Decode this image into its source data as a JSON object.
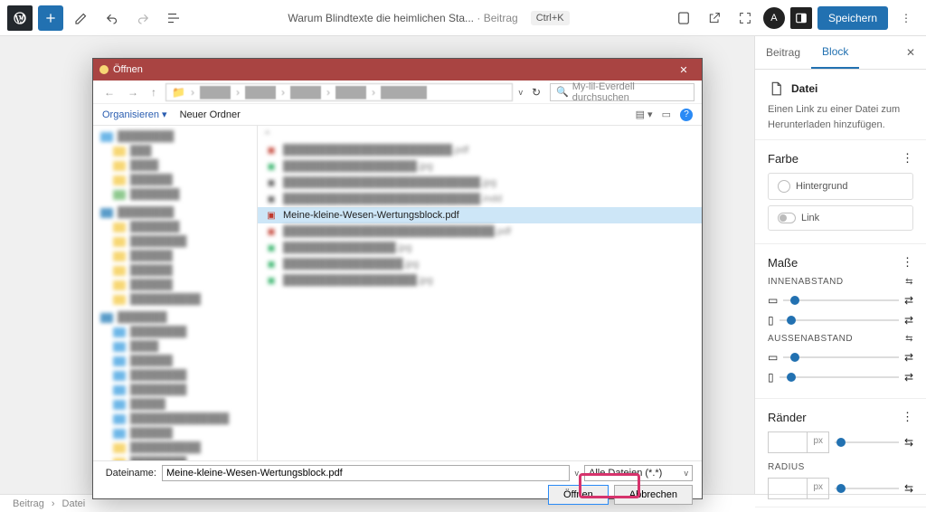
{
  "header": {
    "post_title": "Warum Blindtexte die heimlichen Sta...",
    "post_suffix": "· Beitrag",
    "shortcut": "Ctrl+K",
    "save": "Speichern"
  },
  "sidebar": {
    "tabs": {
      "post": "Beitrag",
      "block": "Block"
    },
    "block": {
      "name": "Datei",
      "desc": "Einen Link zu einer Datei zum Herunterladen hinzufügen."
    },
    "color": {
      "title": "Farbe",
      "bg": "Hintergrund",
      "link": "Link"
    },
    "dims": {
      "title": "Maße",
      "inner": "INNENABSTAND",
      "outer": "AUSSENABSTAND"
    },
    "border": {
      "title": "Ränder",
      "px": "px"
    },
    "radius": {
      "title": "RADIUS",
      "px": "px"
    }
  },
  "breadcrumb": {
    "a": "Beitrag",
    "b": "Datei"
  },
  "dialog": {
    "title": "Öffnen",
    "search_placeholder": "My-lil-Everdell durchsuchen",
    "organise": "Organisieren ▾",
    "newfolder": "Neuer Ordner",
    "selected_file": "Meine-kleine-Wesen-Wertungsblock.pdf",
    "filename_label": "Dateiname:",
    "filename": "Meine-kleine-Wesen-Wertungsblock.pdf",
    "filetype": "Alle Dateien (*.*)",
    "open": "Öffnen",
    "cancel": "Abbrechen"
  }
}
